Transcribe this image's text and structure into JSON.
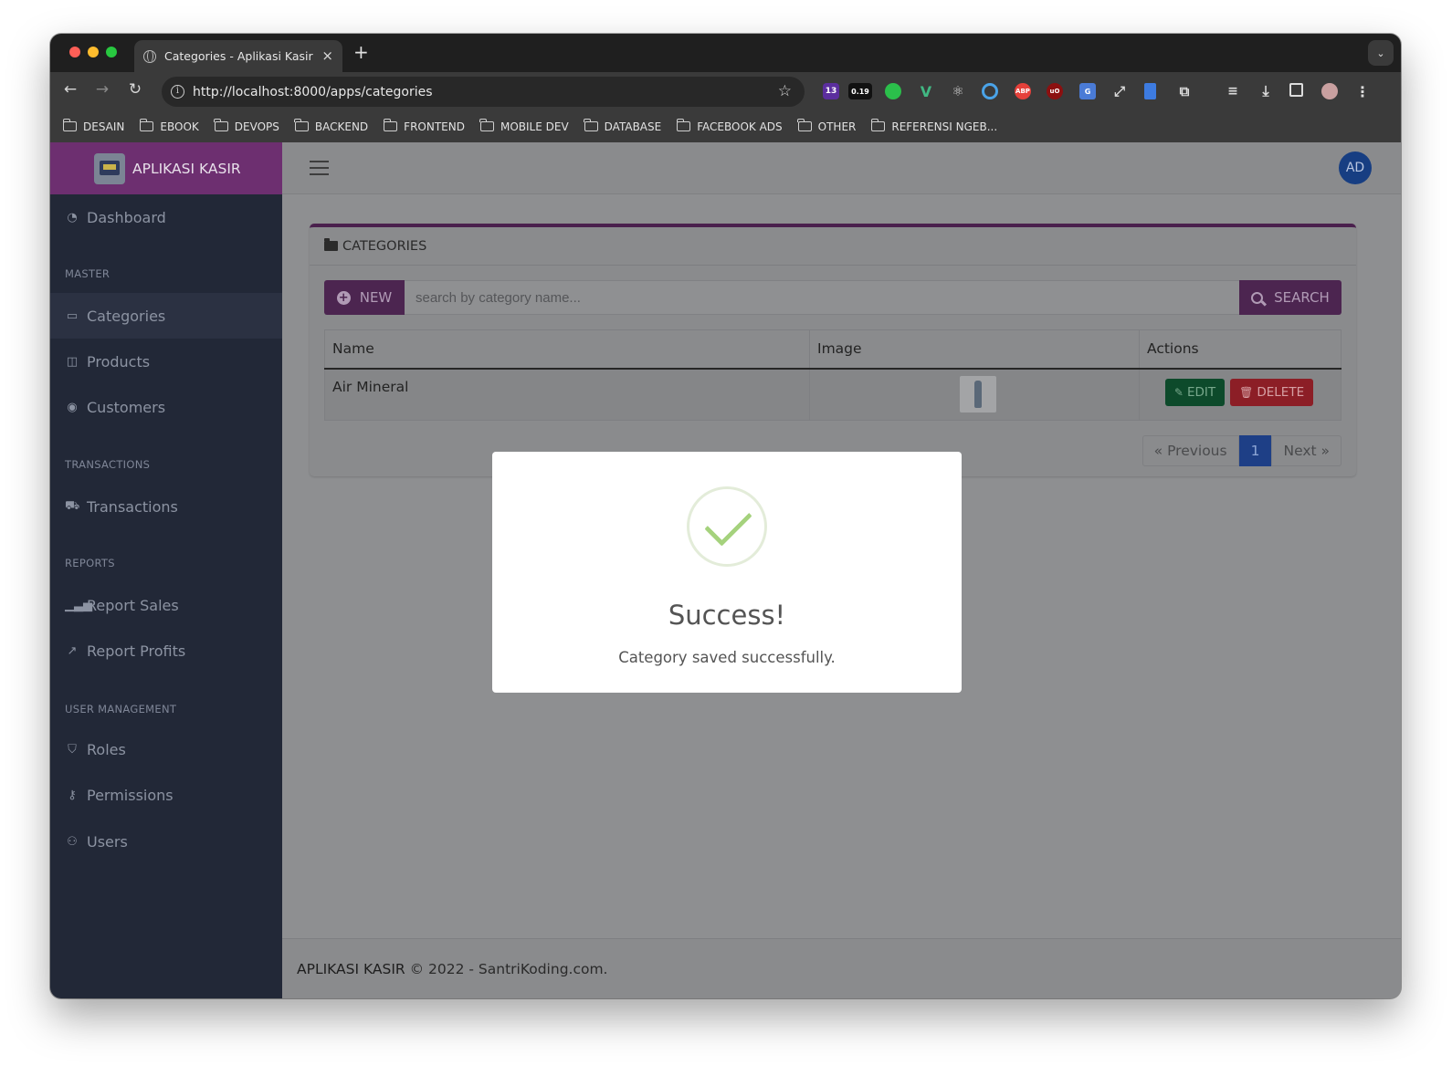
{
  "browser": {
    "tab_title": "Categories - Aplikasi Kasir",
    "tab_close": "×",
    "new_tab": "+",
    "url": "http://localhost:8000/apps/categories",
    "badges": {
      "ext_purple": "13",
      "ext_timer": "0.19"
    },
    "bookmarks": [
      "DESAIN",
      "EBOOK",
      "DEVOPS",
      "BACKEND",
      "FRONTEND",
      "MOBILE DEV",
      "DATABASE",
      "FACEBOOK ADS",
      "OTHER",
      "REFERENSI NGEB..."
    ]
  },
  "sidebar": {
    "brand": "APLIKASI KASIR",
    "items": {
      "dashboard": "Dashboard",
      "master_head": "MASTER",
      "categories": "Categories",
      "products": "Products",
      "customers": "Customers",
      "transactions_head": "TRANSACTIONS",
      "transactions": "Transactions",
      "reports_head": "REPORTS",
      "report_sales": "Report Sales",
      "report_profits": "Report Profits",
      "user_mgmt_head": "USER MANAGEMENT",
      "roles": "Roles",
      "permissions": "Permissions",
      "users": "Users"
    }
  },
  "topbar": {
    "avatar_initials": "AD"
  },
  "main": {
    "card_title": "CATEGORIES",
    "new_label": "NEW",
    "search_placeholder": "search by category name...",
    "search_label": "SEARCH",
    "table": {
      "headers": [
        "Name",
        "Image",
        "Actions"
      ],
      "rows": [
        {
          "name": "Air Mineral",
          "image": "water bottle",
          "edit": "EDIT",
          "delete": "DELETE"
        }
      ]
    },
    "pagination": {
      "prev": "« Previous",
      "current": "1",
      "next": "Next »"
    }
  },
  "footer": {
    "brand": "APLIKASI KASIR",
    "rest": "© 2022 - SantriKoding.com."
  },
  "modal": {
    "title": "Success!",
    "message": "Category saved successfully."
  },
  "colors": {
    "brand_purple": "#6d2f70",
    "sidebar": "#222837",
    "success_green": "#a5d27d",
    "edit_green": "#198754",
    "delete_red": "#dc3545",
    "page_blue": "#0d6efd"
  }
}
